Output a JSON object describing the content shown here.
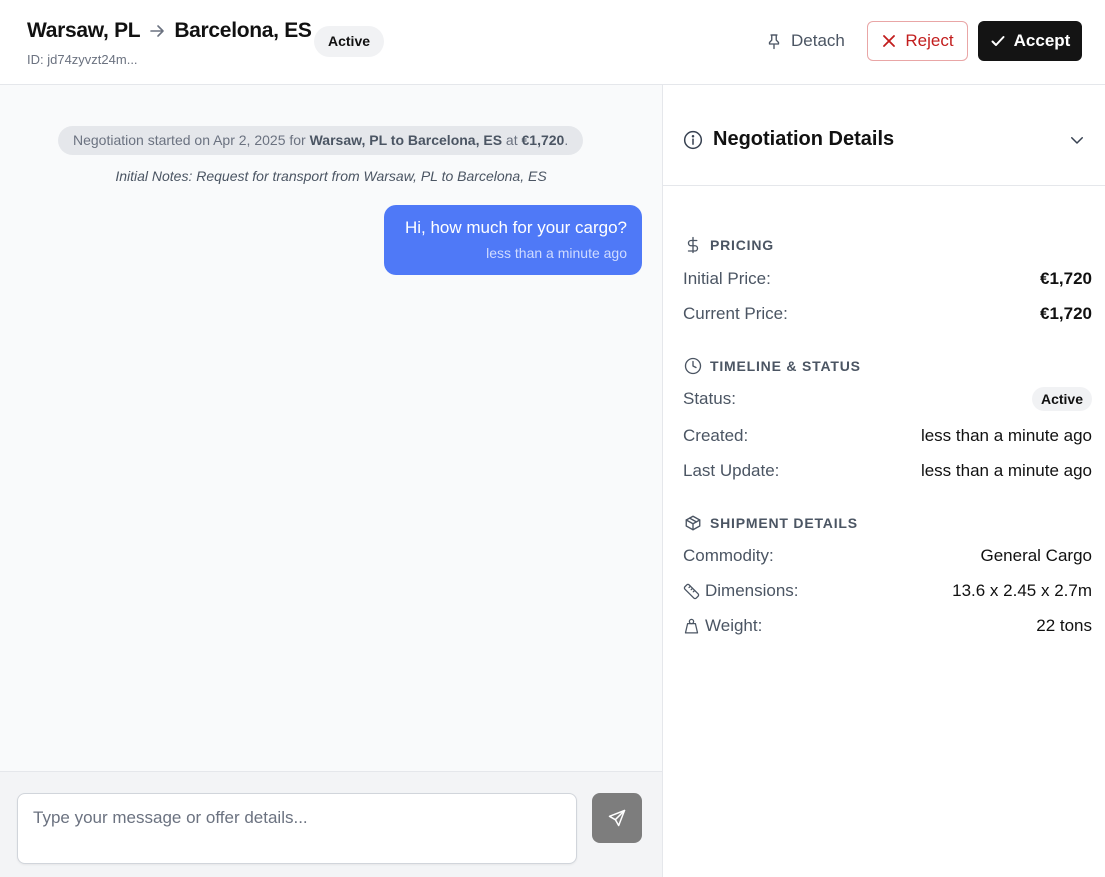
{
  "header": {
    "origin": "Warsaw, PL",
    "destination": "Barcelona, ES",
    "id_text": "ID: jd74zyvzt24m...",
    "status_badge": "Active",
    "detach_label": "Detach",
    "reject_label": "Reject",
    "accept_label": "Accept"
  },
  "chat": {
    "system_prefix": "Negotiation started on Apr 2, 2025 for ",
    "system_route": "Warsaw, PL to Barcelona, ES",
    "system_at": " at ",
    "system_price": "€1,720",
    "system_suffix": ".",
    "initial_notes": "Initial Notes: Request for transport from Warsaw, PL to Barcelona, ES",
    "messages": [
      {
        "text": "Hi, how much for your cargo?",
        "time": "less than a minute ago"
      }
    ]
  },
  "composer": {
    "placeholder": "Type your message or offer details..."
  },
  "sidebar": {
    "title": "Negotiation Details",
    "pricing": {
      "label": "PRICING",
      "initial_label": "Initial Price:",
      "initial_value": "€1,720",
      "current_label": "Current Price:",
      "current_value": "€1,720"
    },
    "timeline": {
      "label": "TIMELINE & STATUS",
      "status_label": "Status:",
      "status_value": "Active",
      "created_label": "Created:",
      "created_value": "less than a minute ago",
      "updated_label": "Last Update:",
      "updated_value": "less than a minute ago"
    },
    "shipment": {
      "label": "SHIPMENT DETAILS",
      "commodity_label": "Commodity:",
      "commodity_value": "General Cargo",
      "dimensions_label": "Dimensions:",
      "dimensions_value": "13.6 x 2.45 x 2.7m",
      "weight_label": "Weight:",
      "weight_value": "22 tons"
    }
  },
  "colors": {
    "accent_blue": "#4f79f7",
    "reject_red": "#c21d1d",
    "accept_dark": "#141414"
  }
}
